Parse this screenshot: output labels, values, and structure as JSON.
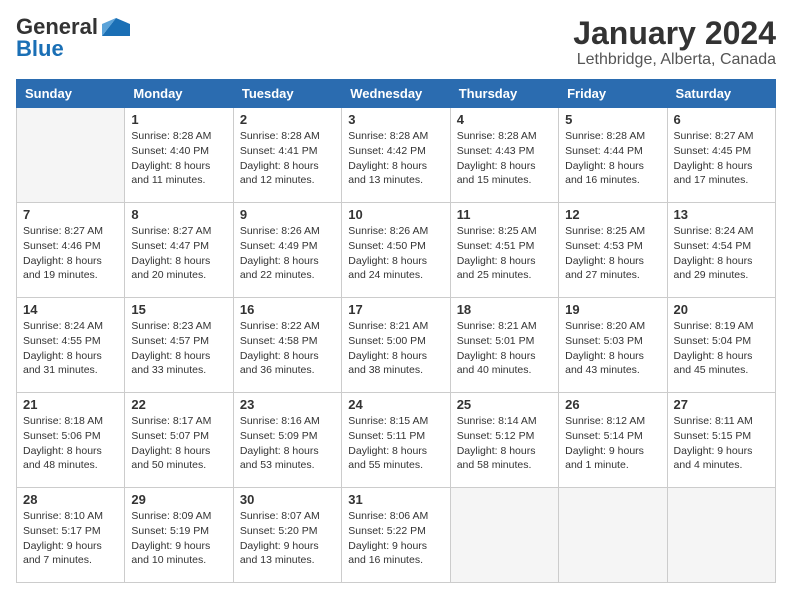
{
  "header": {
    "logo_general": "General",
    "logo_blue": "Blue",
    "month_title": "January 2024",
    "location": "Lethbridge, Alberta, Canada"
  },
  "weekdays": [
    "Sunday",
    "Monday",
    "Tuesday",
    "Wednesday",
    "Thursday",
    "Friday",
    "Saturday"
  ],
  "weeks": [
    [
      {
        "day": "",
        "sunrise": "",
        "sunset": "",
        "daylight": ""
      },
      {
        "day": "1",
        "sunrise": "Sunrise: 8:28 AM",
        "sunset": "Sunset: 4:40 PM",
        "daylight": "Daylight: 8 hours and 11 minutes."
      },
      {
        "day": "2",
        "sunrise": "Sunrise: 8:28 AM",
        "sunset": "Sunset: 4:41 PM",
        "daylight": "Daylight: 8 hours and 12 minutes."
      },
      {
        "day": "3",
        "sunrise": "Sunrise: 8:28 AM",
        "sunset": "Sunset: 4:42 PM",
        "daylight": "Daylight: 8 hours and 13 minutes."
      },
      {
        "day": "4",
        "sunrise": "Sunrise: 8:28 AM",
        "sunset": "Sunset: 4:43 PM",
        "daylight": "Daylight: 8 hours and 15 minutes."
      },
      {
        "day": "5",
        "sunrise": "Sunrise: 8:28 AM",
        "sunset": "Sunset: 4:44 PM",
        "daylight": "Daylight: 8 hours and 16 minutes."
      },
      {
        "day": "6",
        "sunrise": "Sunrise: 8:27 AM",
        "sunset": "Sunset: 4:45 PM",
        "daylight": "Daylight: 8 hours and 17 minutes."
      }
    ],
    [
      {
        "day": "7",
        "sunrise": "Sunrise: 8:27 AM",
        "sunset": "Sunset: 4:46 PM",
        "daylight": "Daylight: 8 hours and 19 minutes."
      },
      {
        "day": "8",
        "sunrise": "Sunrise: 8:27 AM",
        "sunset": "Sunset: 4:47 PM",
        "daylight": "Daylight: 8 hours and 20 minutes."
      },
      {
        "day": "9",
        "sunrise": "Sunrise: 8:26 AM",
        "sunset": "Sunset: 4:49 PM",
        "daylight": "Daylight: 8 hours and 22 minutes."
      },
      {
        "day": "10",
        "sunrise": "Sunrise: 8:26 AM",
        "sunset": "Sunset: 4:50 PM",
        "daylight": "Daylight: 8 hours and 24 minutes."
      },
      {
        "day": "11",
        "sunrise": "Sunrise: 8:25 AM",
        "sunset": "Sunset: 4:51 PM",
        "daylight": "Daylight: 8 hours and 25 minutes."
      },
      {
        "day": "12",
        "sunrise": "Sunrise: 8:25 AM",
        "sunset": "Sunset: 4:53 PM",
        "daylight": "Daylight: 8 hours and 27 minutes."
      },
      {
        "day": "13",
        "sunrise": "Sunrise: 8:24 AM",
        "sunset": "Sunset: 4:54 PM",
        "daylight": "Daylight: 8 hours and 29 minutes."
      }
    ],
    [
      {
        "day": "14",
        "sunrise": "Sunrise: 8:24 AM",
        "sunset": "Sunset: 4:55 PM",
        "daylight": "Daylight: 8 hours and 31 minutes."
      },
      {
        "day": "15",
        "sunrise": "Sunrise: 8:23 AM",
        "sunset": "Sunset: 4:57 PM",
        "daylight": "Daylight: 8 hours and 33 minutes."
      },
      {
        "day": "16",
        "sunrise": "Sunrise: 8:22 AM",
        "sunset": "Sunset: 4:58 PM",
        "daylight": "Daylight: 8 hours and 36 minutes."
      },
      {
        "day": "17",
        "sunrise": "Sunrise: 8:21 AM",
        "sunset": "Sunset: 5:00 PM",
        "daylight": "Daylight: 8 hours and 38 minutes."
      },
      {
        "day": "18",
        "sunrise": "Sunrise: 8:21 AM",
        "sunset": "Sunset: 5:01 PM",
        "daylight": "Daylight: 8 hours and 40 minutes."
      },
      {
        "day": "19",
        "sunrise": "Sunrise: 8:20 AM",
        "sunset": "Sunset: 5:03 PM",
        "daylight": "Daylight: 8 hours and 43 minutes."
      },
      {
        "day": "20",
        "sunrise": "Sunrise: 8:19 AM",
        "sunset": "Sunset: 5:04 PM",
        "daylight": "Daylight: 8 hours and 45 minutes."
      }
    ],
    [
      {
        "day": "21",
        "sunrise": "Sunrise: 8:18 AM",
        "sunset": "Sunset: 5:06 PM",
        "daylight": "Daylight: 8 hours and 48 minutes."
      },
      {
        "day": "22",
        "sunrise": "Sunrise: 8:17 AM",
        "sunset": "Sunset: 5:07 PM",
        "daylight": "Daylight: 8 hours and 50 minutes."
      },
      {
        "day": "23",
        "sunrise": "Sunrise: 8:16 AM",
        "sunset": "Sunset: 5:09 PM",
        "daylight": "Daylight: 8 hours and 53 minutes."
      },
      {
        "day": "24",
        "sunrise": "Sunrise: 8:15 AM",
        "sunset": "Sunset: 5:11 PM",
        "daylight": "Daylight: 8 hours and 55 minutes."
      },
      {
        "day": "25",
        "sunrise": "Sunrise: 8:14 AM",
        "sunset": "Sunset: 5:12 PM",
        "daylight": "Daylight: 8 hours and 58 minutes."
      },
      {
        "day": "26",
        "sunrise": "Sunrise: 8:12 AM",
        "sunset": "Sunset: 5:14 PM",
        "daylight": "Daylight: 9 hours and 1 minute."
      },
      {
        "day": "27",
        "sunrise": "Sunrise: 8:11 AM",
        "sunset": "Sunset: 5:15 PM",
        "daylight": "Daylight: 9 hours and 4 minutes."
      }
    ],
    [
      {
        "day": "28",
        "sunrise": "Sunrise: 8:10 AM",
        "sunset": "Sunset: 5:17 PM",
        "daylight": "Daylight: 9 hours and 7 minutes."
      },
      {
        "day": "29",
        "sunrise": "Sunrise: 8:09 AM",
        "sunset": "Sunset: 5:19 PM",
        "daylight": "Daylight: 9 hours and 10 minutes."
      },
      {
        "day": "30",
        "sunrise": "Sunrise: 8:07 AM",
        "sunset": "Sunset: 5:20 PM",
        "daylight": "Daylight: 9 hours and 13 minutes."
      },
      {
        "day": "31",
        "sunrise": "Sunrise: 8:06 AM",
        "sunset": "Sunset: 5:22 PM",
        "daylight": "Daylight: 9 hours and 16 minutes."
      },
      {
        "day": "",
        "sunrise": "",
        "sunset": "",
        "daylight": ""
      },
      {
        "day": "",
        "sunrise": "",
        "sunset": "",
        "daylight": ""
      },
      {
        "day": "",
        "sunrise": "",
        "sunset": "",
        "daylight": ""
      }
    ]
  ]
}
